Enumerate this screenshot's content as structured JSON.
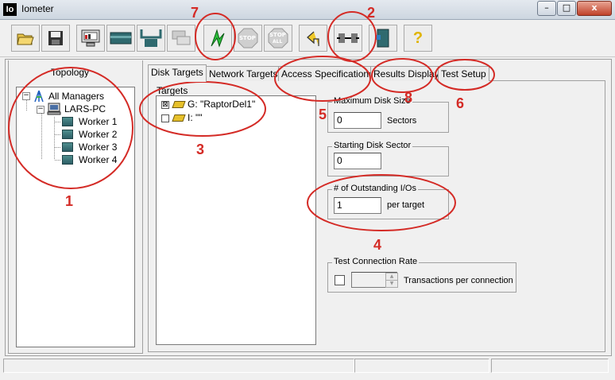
{
  "window": {
    "app_icon": "Io",
    "title": "Iometer",
    "minimize": "–",
    "maximize": "□",
    "close": "x"
  },
  "toolbar": {
    "buttons": [
      {
        "icon": "open-icon"
      },
      {
        "icon": "save-icon"
      },
      {
        "icon": "display-icon"
      },
      {
        "icon": "new-manager-icon"
      },
      {
        "icon": "new-worker-icon"
      },
      {
        "icon": "copy-worker-icon"
      },
      {
        "icon": "start-icon"
      },
      {
        "icon": "stop-icon",
        "label": "STOP"
      },
      {
        "icon": "stop-all-icon",
        "label": "STOP",
        "label2": "ALL"
      },
      {
        "icon": "reset-icon"
      },
      {
        "icon": "disconnect-icon"
      },
      {
        "icon": "exit-icon"
      },
      {
        "icon": "help-icon",
        "label": "?"
      }
    ]
  },
  "topology": {
    "title": "Topology",
    "root": "All Managers",
    "manager": "LARS-PC",
    "workers": [
      "Worker 1",
      "Worker 2",
      "Worker 3",
      "Worker 4"
    ]
  },
  "tabs": [
    "Disk Targets",
    "Network Targets",
    "Access Specifications",
    "Results Display",
    "Test Setup"
  ],
  "targets": {
    "title": "Targets",
    "items": [
      {
        "checked": "⊠",
        "label": "G: \"RaptorDel1\""
      },
      {
        "checked": "",
        "label": "I: \"\""
      }
    ]
  },
  "max_disk_size": {
    "title": "Maximum Disk Size",
    "value": "0",
    "unit": "Sectors"
  },
  "starting_disk_sector": {
    "title": "Starting Disk Sector",
    "value": "0"
  },
  "outstanding_ios": {
    "title": "# of Outstanding I/Os",
    "value": "1",
    "unit": "per target"
  },
  "test_connection_rate": {
    "title": "Test Connection Rate",
    "value": "",
    "unit": "Transactions per connection"
  },
  "annotations": [
    "1",
    "2",
    "3",
    "4",
    "5",
    "6",
    "7",
    "8"
  ],
  "colors": {
    "annotation": "#d42b26",
    "worker_icon": "#3b7476",
    "drive_icon": "#e6c02a"
  }
}
